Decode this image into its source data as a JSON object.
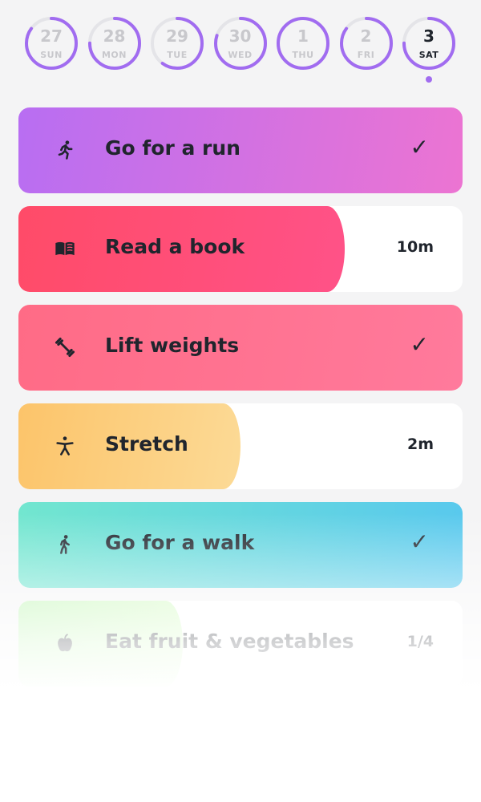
{
  "week": [
    {
      "num": "27",
      "name": "SUN",
      "progress": 0.85
    },
    {
      "num": "28",
      "name": "MON",
      "progress": 0.75
    },
    {
      "num": "29",
      "name": "TUE",
      "progress": 0.6
    },
    {
      "num": "30",
      "name": "WED",
      "progress": 0.8
    },
    {
      "num": "1",
      "name": "THU",
      "progress": 1.0
    },
    {
      "num": "2",
      "name": "FRI",
      "progress": 0.85
    },
    {
      "num": "3",
      "name": "SAT",
      "progress": 0.75,
      "selected": true
    }
  ],
  "colors": {
    "accent": "#a16cf0",
    "ring_track": "#e4e4e8"
  },
  "habits": [
    {
      "label": "Go for a run",
      "icon": "running-icon",
      "status": "✓",
      "done": true,
      "progress": 1.0,
      "gradient": [
        "#b86ef2",
        "#ec74d2"
      ]
    },
    {
      "label": "Read a book",
      "icon": "book-icon",
      "status": "10m",
      "done": false,
      "progress": 0.735,
      "gradient": [
        "#ff4b68",
        "#ff5288"
      ]
    },
    {
      "label": "Lift weights",
      "icon": "dumbbell-icon",
      "status": "✓",
      "done": true,
      "progress": 1.0,
      "gradient": [
        "#ff6b86",
        "#ff7a9c"
      ]
    },
    {
      "label": "Stretch",
      "icon": "stretch-icon",
      "status": "2m",
      "done": false,
      "progress": 0.5,
      "gradient": [
        "#fcc46a",
        "#fcda96"
      ]
    },
    {
      "label": "Go for a walk",
      "icon": "walking-icon",
      "status": "✓",
      "done": true,
      "progress": 1.0,
      "gradient": [
        "#72e6cf",
        "#58c8ee"
      ]
    },
    {
      "label": "Eat fruit & vegetables",
      "icon": "apple-icon",
      "status": "1/4",
      "done": false,
      "progress": 0.37,
      "gradient": [
        "#bff5b4",
        "#d8fbc6"
      ]
    }
  ]
}
